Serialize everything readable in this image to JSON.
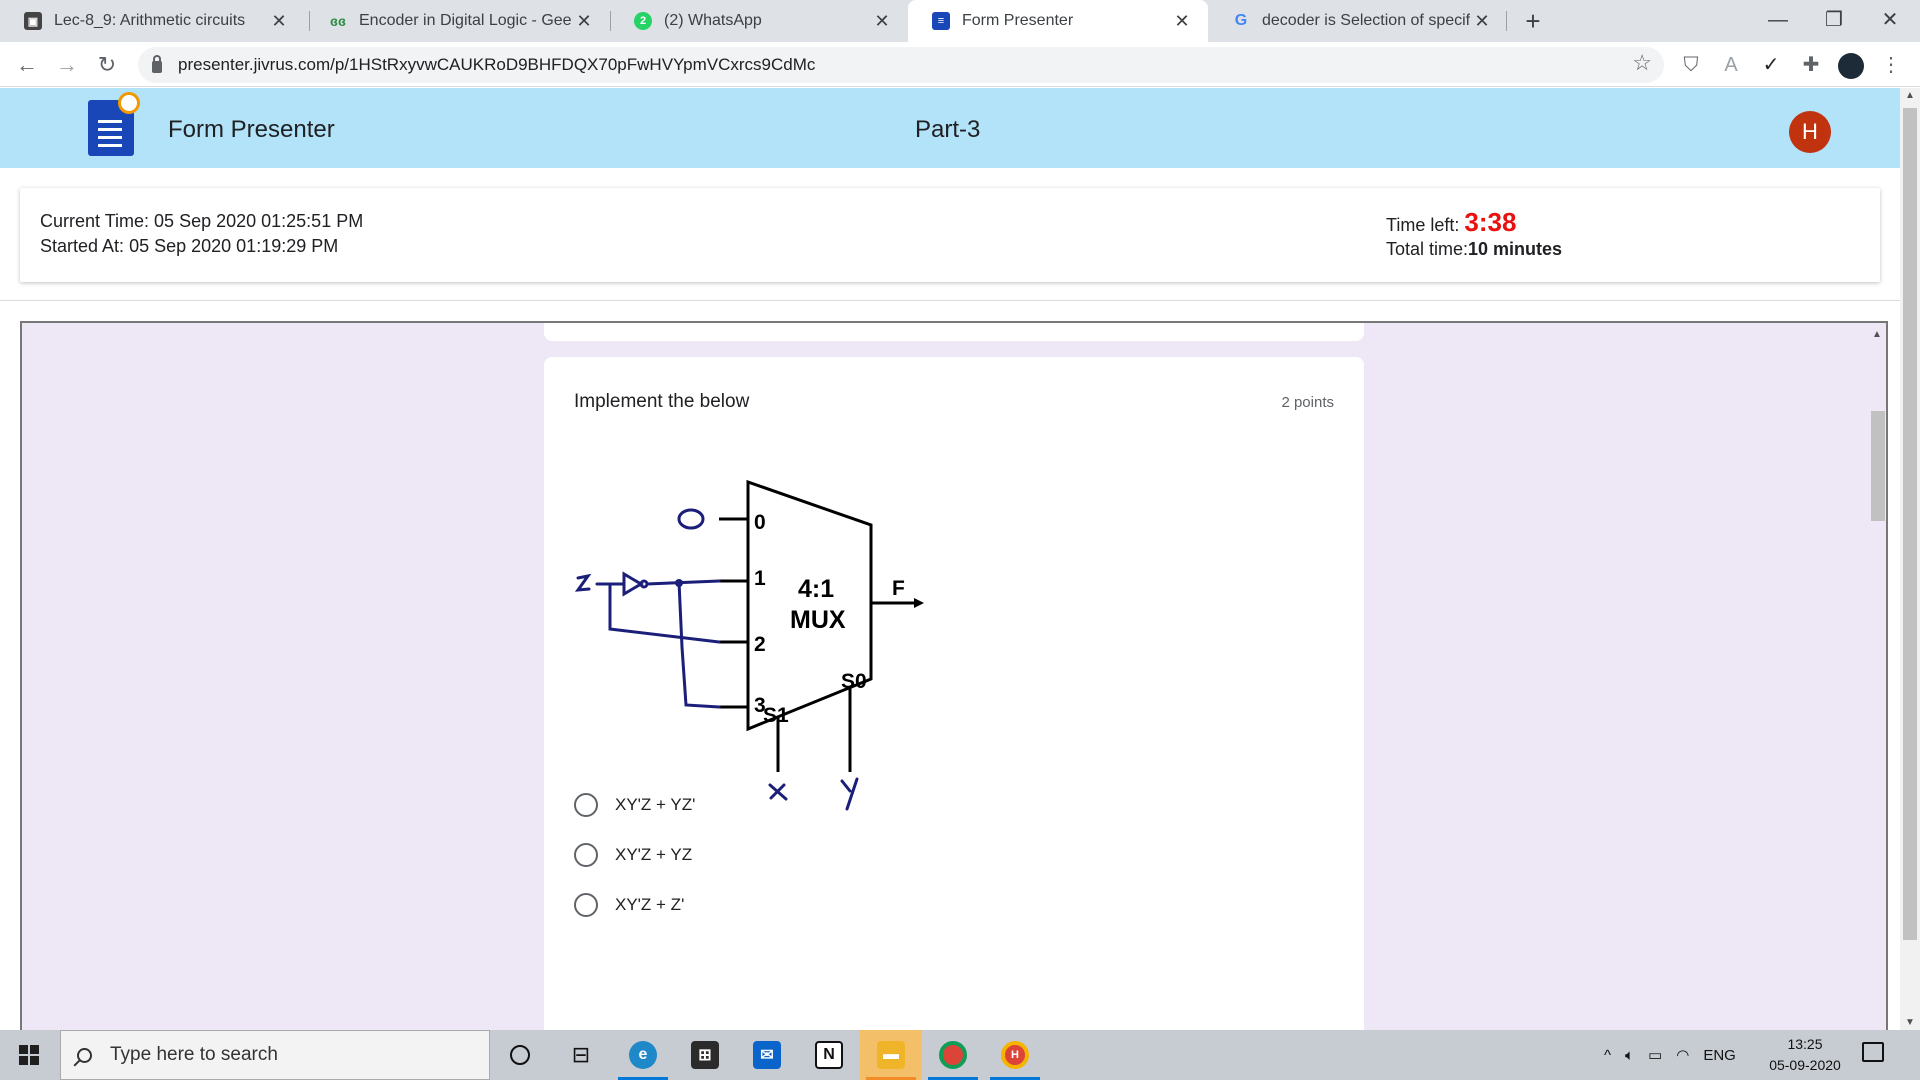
{
  "browser": {
    "tabs": [
      {
        "title": "Lec-8_9: Arithmetic circuits",
        "favicon": "classroom-icon",
        "active": false
      },
      {
        "title": "Encoder in Digital Logic - Geeksfo",
        "favicon": "geeksforgeeks-icon",
        "active": false
      },
      {
        "title": "(2) WhatsApp",
        "favicon": "whatsapp-icon",
        "active": false
      },
      {
        "title": "Form Presenter",
        "favicon": "forms-icon",
        "active": true
      },
      {
        "title": "decoder is Selection of specific ou",
        "favicon": "google-icon",
        "active": false
      }
    ],
    "new_tab_label": "+",
    "url": "presenter.jivrus.com/p/1HStRxyvwCAUKRoD9BHFDQX70pFwHVYpmVCxrcs9CdMc"
  },
  "app": {
    "title": "Form Presenter",
    "part": "Part-3",
    "avatar_letter": "H",
    "header_color": "#b3e3f8"
  },
  "timing": {
    "current_time_label": "Current Time:",
    "current_time_value": "05 Sep 2020 01:25:51 PM",
    "started_label": "Started At:",
    "started_value": "05 Sep 2020 01:19:29 PM",
    "time_left_label": "Time left:",
    "time_left_value": "3:38",
    "total_time_label": "Total time:",
    "total_time_value": "10 minutes",
    "time_left_color": "#e8110f"
  },
  "question": {
    "text": "Implement the below",
    "points": "2 points",
    "diagram": {
      "mux_label_1": "4:1",
      "mux_label_2": "MUX",
      "inputs": [
        "0",
        "1",
        "2",
        "3"
      ],
      "output": "F",
      "select_s1": "S1",
      "select_s0": "S0",
      "input0_hand": "0",
      "input_var_hand": "Z",
      "sel_var_x": "x",
      "sel_var_y": "y"
    },
    "options": [
      "XY'Z + YZ'",
      "XY'Z + YZ",
      "XY'Z + Z'"
    ]
  },
  "taskbar": {
    "search_placeholder": "Type here to search",
    "language": "ENG",
    "time": "13:25",
    "date": "05-09-2020"
  }
}
